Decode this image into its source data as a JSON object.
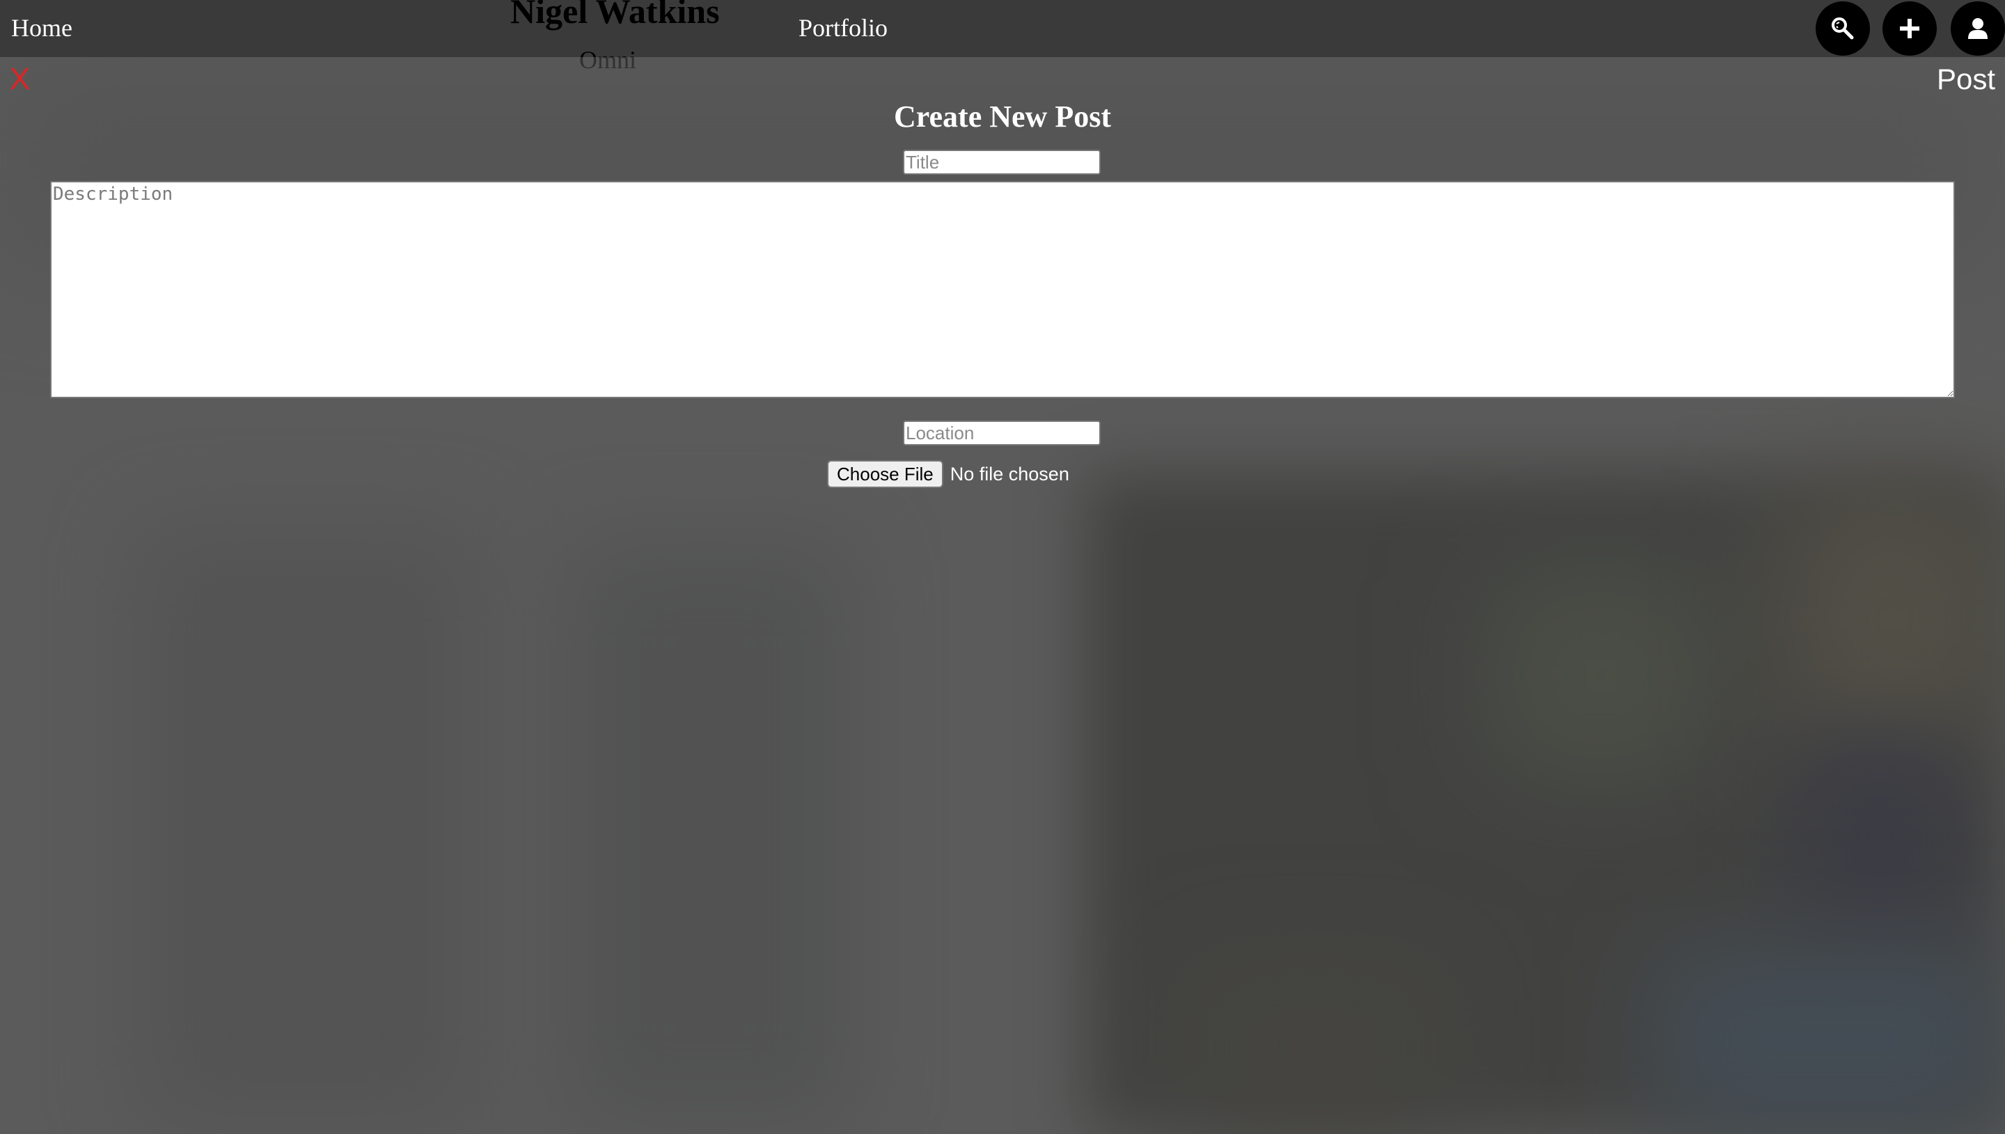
{
  "nav": {
    "home_label": "Home",
    "site_name": "Nigel Watkins",
    "site_subtitle": "Omni",
    "portfolio_label": "Portfolio",
    "icons": [
      "search-icon",
      "plus-icon",
      "user-icon"
    ]
  },
  "modal": {
    "close_label": "X",
    "post_label": "Post",
    "title": "Create New Post",
    "title_placeholder": "Title",
    "description_placeholder": "Description",
    "location_placeholder": "Location",
    "choose_file_label": "Choose File",
    "file_status": "No file chosen"
  },
  "colors": {
    "navbar": "#3a3a3a",
    "overlay": "#5b5b5b",
    "close": "#e02424",
    "icon_button": "#000000"
  }
}
